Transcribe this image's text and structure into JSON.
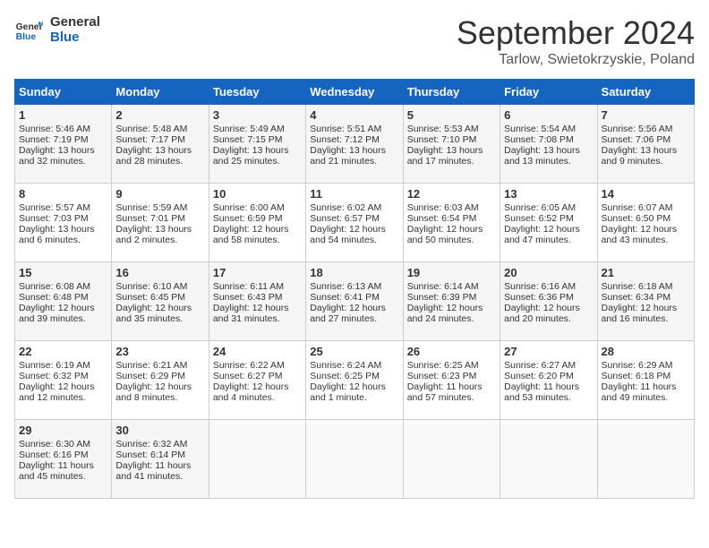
{
  "logo": {
    "line1": "General",
    "line2": "Blue"
  },
  "title": "September 2024",
  "location": "Tarlow, Swietokrzyskie, Poland",
  "days_of_week": [
    "Sunday",
    "Monday",
    "Tuesday",
    "Wednesday",
    "Thursday",
    "Friday",
    "Saturday"
  ],
  "weeks": [
    [
      {
        "day": "1",
        "lines": [
          "Sunrise: 5:46 AM",
          "Sunset: 7:19 PM",
          "Daylight: 13 hours",
          "and 32 minutes."
        ]
      },
      {
        "day": "2",
        "lines": [
          "Sunrise: 5:48 AM",
          "Sunset: 7:17 PM",
          "Daylight: 13 hours",
          "and 28 minutes."
        ]
      },
      {
        "day": "3",
        "lines": [
          "Sunrise: 5:49 AM",
          "Sunset: 7:15 PM",
          "Daylight: 13 hours",
          "and 25 minutes."
        ]
      },
      {
        "day": "4",
        "lines": [
          "Sunrise: 5:51 AM",
          "Sunset: 7:12 PM",
          "Daylight: 13 hours",
          "and 21 minutes."
        ]
      },
      {
        "day": "5",
        "lines": [
          "Sunrise: 5:53 AM",
          "Sunset: 7:10 PM",
          "Daylight: 13 hours",
          "and 17 minutes."
        ]
      },
      {
        "day": "6",
        "lines": [
          "Sunrise: 5:54 AM",
          "Sunset: 7:08 PM",
          "Daylight: 13 hours",
          "and 13 minutes."
        ]
      },
      {
        "day": "7",
        "lines": [
          "Sunrise: 5:56 AM",
          "Sunset: 7:06 PM",
          "Daylight: 13 hours",
          "and 9 minutes."
        ]
      }
    ],
    [
      {
        "day": "8",
        "lines": [
          "Sunrise: 5:57 AM",
          "Sunset: 7:03 PM",
          "Daylight: 13 hours",
          "and 6 minutes."
        ]
      },
      {
        "day": "9",
        "lines": [
          "Sunrise: 5:59 AM",
          "Sunset: 7:01 PM",
          "Daylight: 13 hours",
          "and 2 minutes."
        ]
      },
      {
        "day": "10",
        "lines": [
          "Sunrise: 6:00 AM",
          "Sunset: 6:59 PM",
          "Daylight: 12 hours",
          "and 58 minutes."
        ]
      },
      {
        "day": "11",
        "lines": [
          "Sunrise: 6:02 AM",
          "Sunset: 6:57 PM",
          "Daylight: 12 hours",
          "and 54 minutes."
        ]
      },
      {
        "day": "12",
        "lines": [
          "Sunrise: 6:03 AM",
          "Sunset: 6:54 PM",
          "Daylight: 12 hours",
          "and 50 minutes."
        ]
      },
      {
        "day": "13",
        "lines": [
          "Sunrise: 6:05 AM",
          "Sunset: 6:52 PM",
          "Daylight: 12 hours",
          "and 47 minutes."
        ]
      },
      {
        "day": "14",
        "lines": [
          "Sunrise: 6:07 AM",
          "Sunset: 6:50 PM",
          "Daylight: 12 hours",
          "and 43 minutes."
        ]
      }
    ],
    [
      {
        "day": "15",
        "lines": [
          "Sunrise: 6:08 AM",
          "Sunset: 6:48 PM",
          "Daylight: 12 hours",
          "and 39 minutes."
        ]
      },
      {
        "day": "16",
        "lines": [
          "Sunrise: 6:10 AM",
          "Sunset: 6:45 PM",
          "Daylight: 12 hours",
          "and 35 minutes."
        ]
      },
      {
        "day": "17",
        "lines": [
          "Sunrise: 6:11 AM",
          "Sunset: 6:43 PM",
          "Daylight: 12 hours",
          "and 31 minutes."
        ]
      },
      {
        "day": "18",
        "lines": [
          "Sunrise: 6:13 AM",
          "Sunset: 6:41 PM",
          "Daylight: 12 hours",
          "and 27 minutes."
        ]
      },
      {
        "day": "19",
        "lines": [
          "Sunrise: 6:14 AM",
          "Sunset: 6:39 PM",
          "Daylight: 12 hours",
          "and 24 minutes."
        ]
      },
      {
        "day": "20",
        "lines": [
          "Sunrise: 6:16 AM",
          "Sunset: 6:36 PM",
          "Daylight: 12 hours",
          "and 20 minutes."
        ]
      },
      {
        "day": "21",
        "lines": [
          "Sunrise: 6:18 AM",
          "Sunset: 6:34 PM",
          "Daylight: 12 hours",
          "and 16 minutes."
        ]
      }
    ],
    [
      {
        "day": "22",
        "lines": [
          "Sunrise: 6:19 AM",
          "Sunset: 6:32 PM",
          "Daylight: 12 hours",
          "and 12 minutes."
        ]
      },
      {
        "day": "23",
        "lines": [
          "Sunrise: 6:21 AM",
          "Sunset: 6:29 PM",
          "Daylight: 12 hours",
          "and 8 minutes."
        ]
      },
      {
        "day": "24",
        "lines": [
          "Sunrise: 6:22 AM",
          "Sunset: 6:27 PM",
          "Daylight: 12 hours",
          "and 4 minutes."
        ]
      },
      {
        "day": "25",
        "lines": [
          "Sunrise: 6:24 AM",
          "Sunset: 6:25 PM",
          "Daylight: 12 hours",
          "and 1 minute."
        ]
      },
      {
        "day": "26",
        "lines": [
          "Sunrise: 6:25 AM",
          "Sunset: 6:23 PM",
          "Daylight: 11 hours",
          "and 57 minutes."
        ]
      },
      {
        "day": "27",
        "lines": [
          "Sunrise: 6:27 AM",
          "Sunset: 6:20 PM",
          "Daylight: 11 hours",
          "and 53 minutes."
        ]
      },
      {
        "day": "28",
        "lines": [
          "Sunrise: 6:29 AM",
          "Sunset: 6:18 PM",
          "Daylight: 11 hours",
          "and 49 minutes."
        ]
      }
    ],
    [
      {
        "day": "29",
        "lines": [
          "Sunrise: 6:30 AM",
          "Sunset: 6:16 PM",
          "Daylight: 11 hours",
          "and 45 minutes."
        ]
      },
      {
        "day": "30",
        "lines": [
          "Sunrise: 6:32 AM",
          "Sunset: 6:14 PM",
          "Daylight: 11 hours",
          "and 41 minutes."
        ]
      },
      {
        "day": "",
        "lines": []
      },
      {
        "day": "",
        "lines": []
      },
      {
        "day": "",
        "lines": []
      },
      {
        "day": "",
        "lines": []
      },
      {
        "day": "",
        "lines": []
      }
    ]
  ]
}
